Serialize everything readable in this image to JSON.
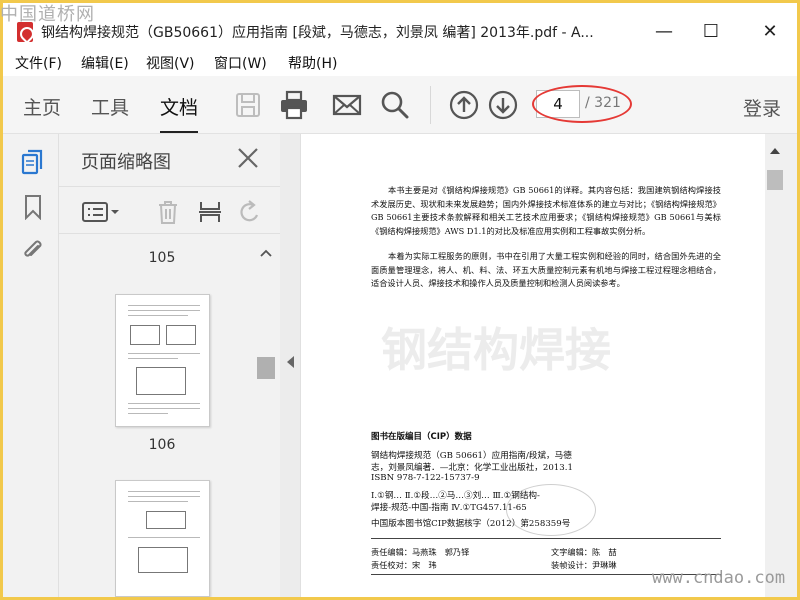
{
  "watermark_top": "中国道桥网",
  "watermark_bottom": "www.cndao.com",
  "window": {
    "title": "钢结构焊接规范（GB50661）应用指南 [段斌，马德志，刘景凤 编著] 2013年.pdf - A...",
    "minimize": "—",
    "maximize": "☐",
    "close": "✕"
  },
  "menu": [
    "文件(F)",
    "编辑(E)",
    "视图(V)",
    "窗口(W)",
    "帮助(H)"
  ],
  "toolbar": {
    "tabs": [
      "主页",
      "工具",
      "文档"
    ],
    "active_tab": "文档",
    "icons": [
      "save-icon",
      "print-icon",
      "email-icon",
      "search-icon",
      "page-up-icon",
      "page-down-icon"
    ],
    "page_current": "4",
    "page_total": "/ 321",
    "login": "登录",
    "annotation_color": "#e53935"
  },
  "sidebar": {
    "rail_icons": [
      "page-thumbnails-icon",
      "bookmark-icon",
      "attachment-icon"
    ],
    "panel_title": "页面缩略图",
    "thumbnails": [
      {
        "label": "105"
      },
      {
        "label": "106"
      }
    ]
  },
  "document": {
    "paragraphs": [
      "本书主要是对《钢结构焊接规范》GB 50661的详释。其内容包括：我国建筑钢结构焊接技术发展历史、现状和未来发展趋势；国内外焊接技术标准体系的建立与对比；《钢结构焊接规范》GB 50661主要技术条款解释和相关工艺技术应用要求；《钢结构焊接规范》GB 50661与美标《钢结构焊接规范》AWS D1.1的对比及标准应用实例和工程事故实例分析。",
      "本着为实际工程服务的原则，书中在引用了大量工程实例和经验的同时，结合国外先进的全面质量管理理念，将人、机、料、法、环五大质量控制元素有机地与焊接工程过程理念相结合，适合设计人员、焊接技术和操作人员及质量控制和检测人员阅读参考。"
    ],
    "cip_title": "图书在版编目（CIP）数据",
    "cip_lines": [
      "钢结构焊接规范（GB 50661）应用指南/段斌，马德",
      "志，刘景凤编著．—北京：化学工业出版社，2013.1",
      "ISBN 978-7-122-15737-9",
      "Ⅰ.①钢…  Ⅱ.①段…②马…③刘…  Ⅲ.①钢结构-",
      "焊接-规范-中国-指南  Ⅳ.①TG457.11-65",
      "中国版本图书馆CIP数据核字（2012）第258359号"
    ],
    "credits": [
      {
        "role": "责任编辑：",
        "name": "马燕珠　郭乃铎"
      },
      {
        "role": "文字编辑：",
        "name": "陈　喆"
      },
      {
        "role": "责任校对：",
        "name": "宋　玮"
      },
      {
        "role": "装帧设计：",
        "name": "尹琳琳"
      }
    ]
  }
}
